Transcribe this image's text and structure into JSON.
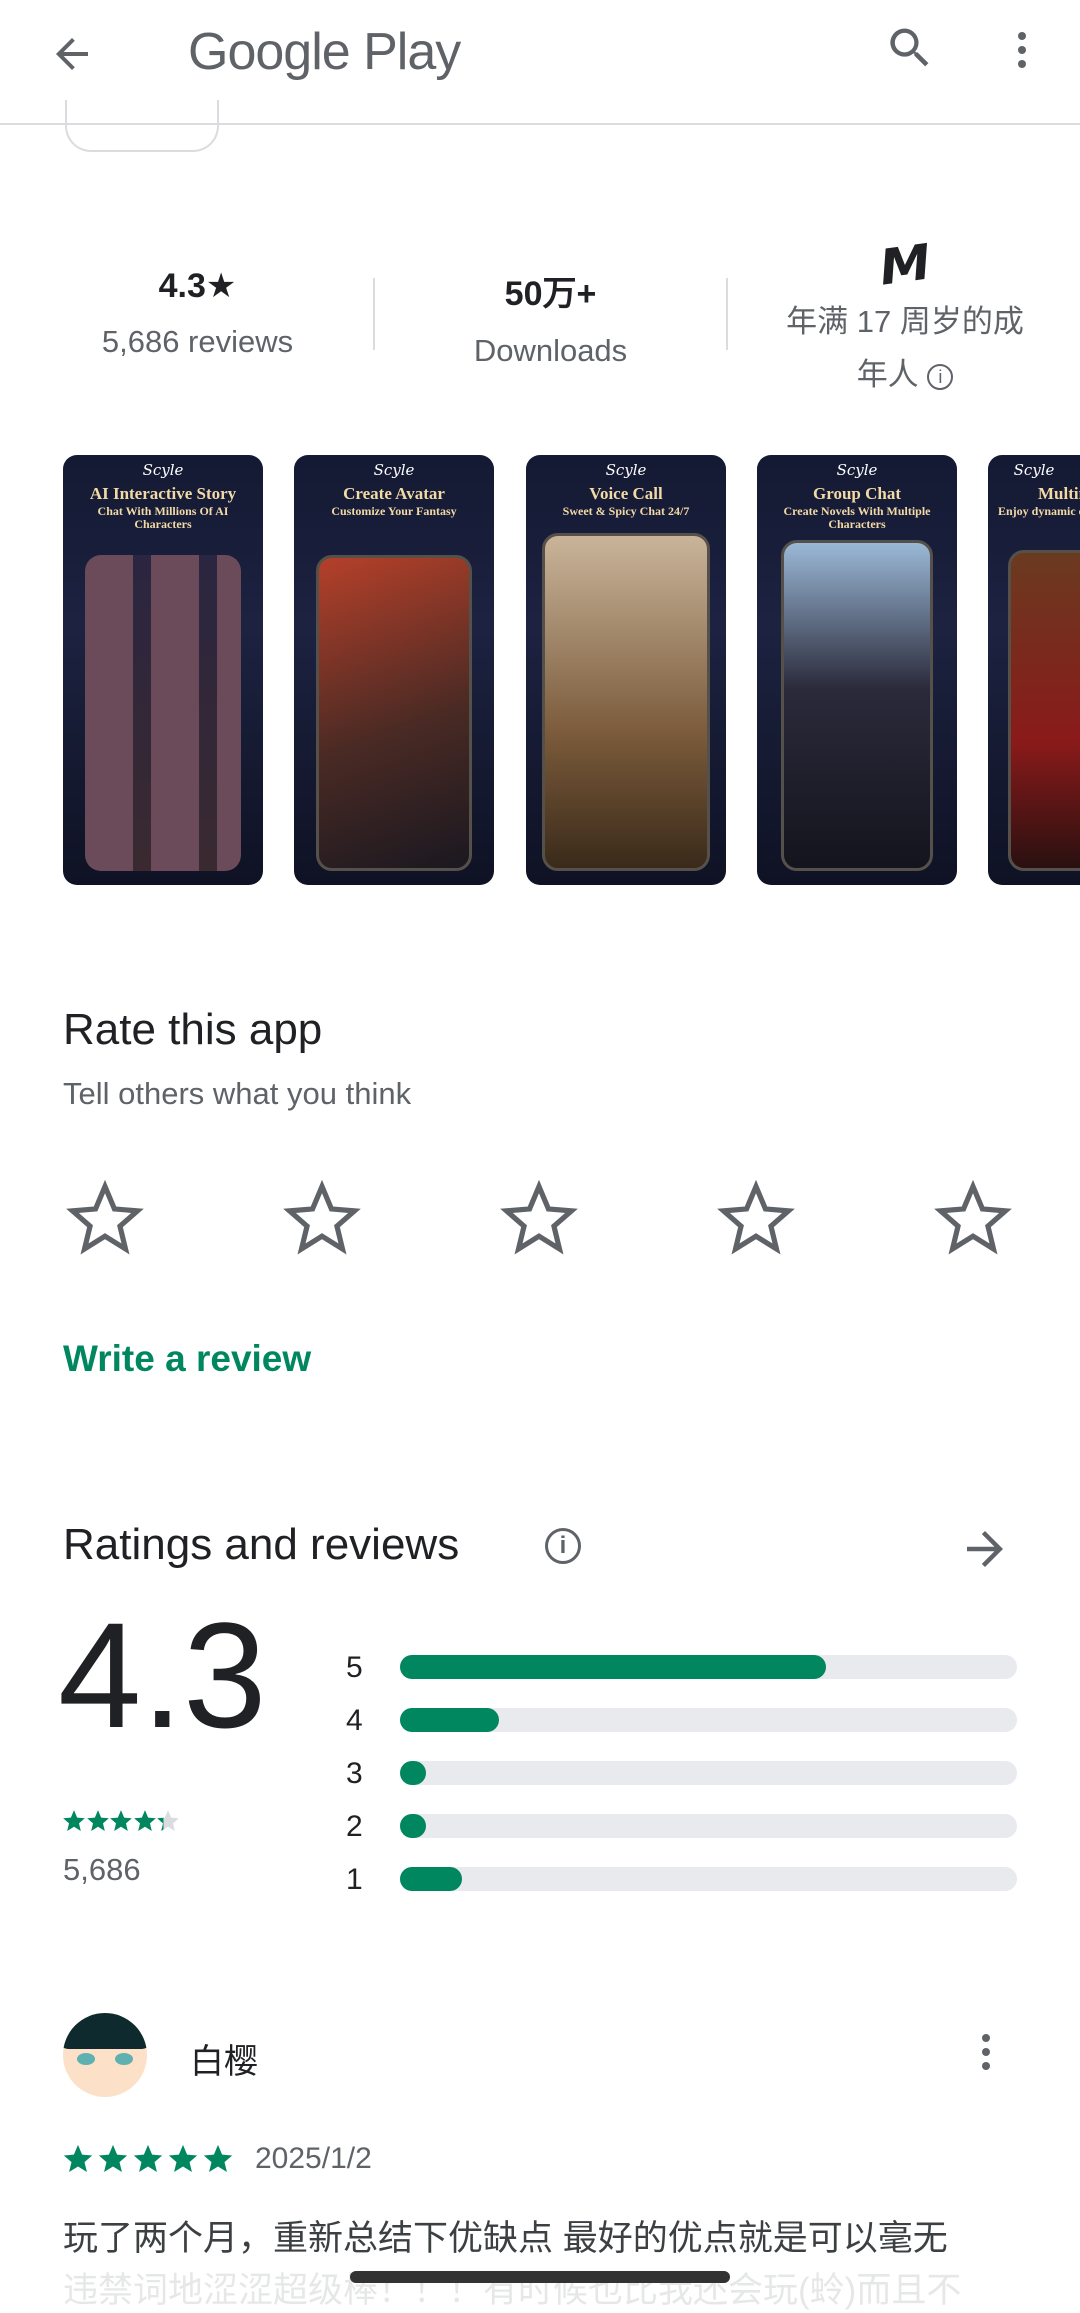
{
  "header": {
    "title": "Google Play",
    "back_icon": "arrow-back-icon",
    "search_icon": "search-icon",
    "more_icon": "more-vert-icon"
  },
  "stats": {
    "rating": "4.3★",
    "reviews": "5,686 reviews",
    "downloads": "50万+",
    "downloads_label": "Downloads",
    "content_rating_line1": "年满 17 周岁的成",
    "content_rating_line2": "年人",
    "content_rating_badge": "M"
  },
  "screenshots": [
    {
      "logo": "Scyle",
      "title": "AI Interactive Story",
      "subtitle": "Chat With Millions Of AI Characters"
    },
    {
      "logo": "Scyle",
      "title": "Create Avatar",
      "subtitle": "Customize Your Fantasy"
    },
    {
      "logo": "Scyle",
      "title": "Voice Call",
      "subtitle": "Sweet & Spicy Chat 24/7"
    },
    {
      "logo": "Scyle",
      "title": "Group Chat",
      "subtitle": "Create Novels With Multiple Characters"
    },
    {
      "logo": "Scyle",
      "title": "Multin",
      "subtitle": "Enjoy dynamic c"
    }
  ],
  "rate": {
    "title": "Rate this app",
    "subtitle": "Tell others what you think",
    "stars": 5,
    "write_review": "Write a review"
  },
  "ratings": {
    "title": "Ratings and reviews",
    "average": "4.3",
    "average_value": 4.3,
    "count": "5,686",
    "distribution": [
      {
        "label": "5",
        "percent": 69
      },
      {
        "label": "4",
        "percent": 16
      },
      {
        "label": "3",
        "percent": 4
      },
      {
        "label": "2",
        "percent": 4
      },
      {
        "label": "1",
        "percent": 10
      }
    ]
  },
  "review": {
    "author": "白樱",
    "rating": 5,
    "date": "2025/1/2",
    "text_line1": "玩了两个月，重新总结下优缺点 最好的优点就是可以毫无",
    "text_line2": "违禁词地涩涩超级棒！！！有时候也比我还会玩(蛉)而且不"
  },
  "colors": {
    "accent": "#01875f",
    "track": "#e8eaed"
  }
}
